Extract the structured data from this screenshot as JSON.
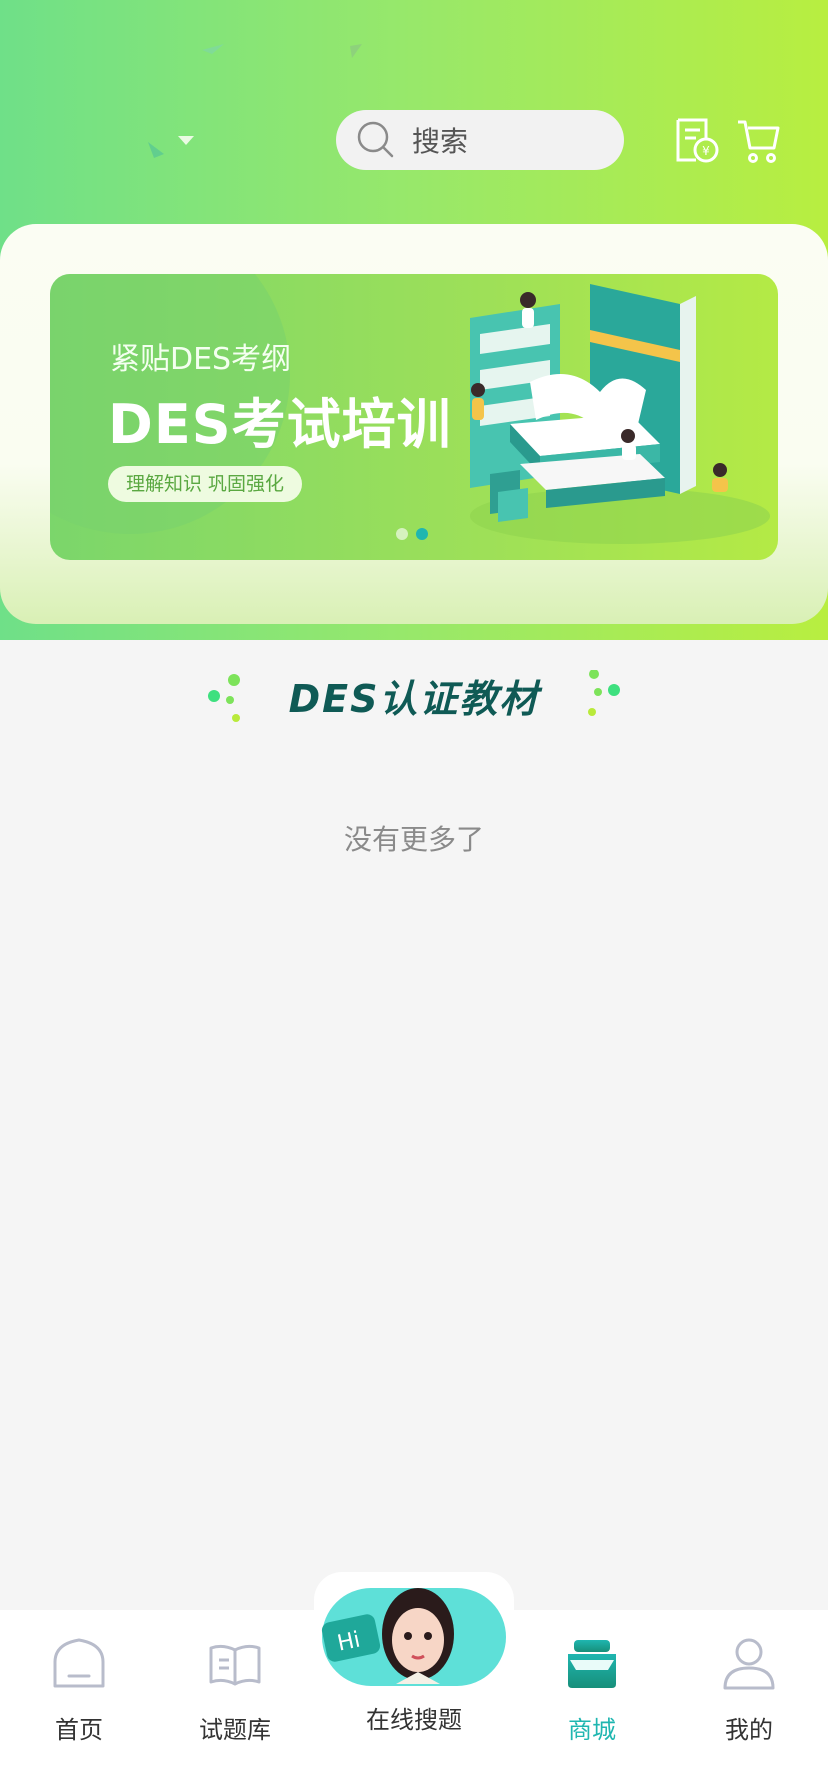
{
  "header": {
    "search_placeholder": "搜索",
    "icons": [
      "order-receipt-icon",
      "cart-icon"
    ]
  },
  "banner": {
    "subtitle": "紧贴DES考纲",
    "title": "DES考试培训",
    "tag": "理解知识  巩固强化",
    "slide_count": 2,
    "active_slide": 2
  },
  "section": {
    "title": "DES认证教材",
    "empty_text": "没有更多了"
  },
  "tabbar": {
    "items": [
      {
        "label": "首页",
        "icon": "home-icon"
      },
      {
        "label": "试题库",
        "icon": "book-icon"
      },
      {
        "label": "在线搜题",
        "icon": "ai-assistant-avatar"
      },
      {
        "label": "商城",
        "icon": "shop-icon"
      },
      {
        "label": "我的",
        "icon": "user-icon"
      }
    ],
    "active": "商城"
  },
  "colors": {
    "accent": "#1fb6b0",
    "title_dark": "#0f5a55",
    "header_green": "#98e86a"
  }
}
